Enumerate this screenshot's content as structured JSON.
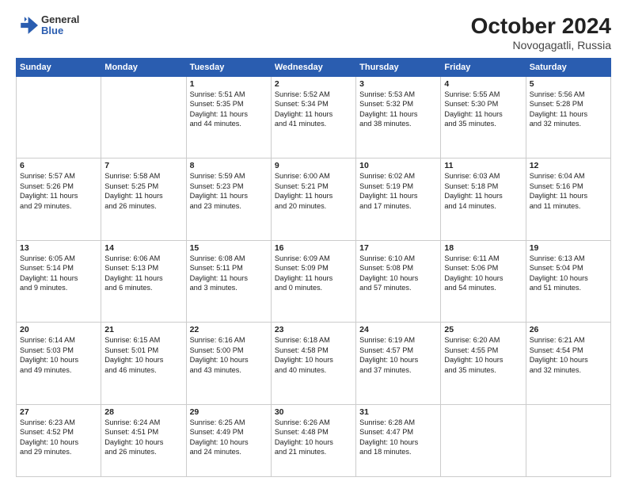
{
  "header": {
    "logo_general": "General",
    "logo_blue": "Blue",
    "month_year": "October 2024",
    "location": "Novogagatli, Russia"
  },
  "weekdays": [
    "Sunday",
    "Monday",
    "Tuesday",
    "Wednesday",
    "Thursday",
    "Friday",
    "Saturday"
  ],
  "weeks": [
    [
      {
        "day": "",
        "info": ""
      },
      {
        "day": "",
        "info": ""
      },
      {
        "day": "1",
        "info": "Sunrise: 5:51 AM\nSunset: 5:35 PM\nDaylight: 11 hours\nand 44 minutes."
      },
      {
        "day": "2",
        "info": "Sunrise: 5:52 AM\nSunset: 5:34 PM\nDaylight: 11 hours\nand 41 minutes."
      },
      {
        "day": "3",
        "info": "Sunrise: 5:53 AM\nSunset: 5:32 PM\nDaylight: 11 hours\nand 38 minutes."
      },
      {
        "day": "4",
        "info": "Sunrise: 5:55 AM\nSunset: 5:30 PM\nDaylight: 11 hours\nand 35 minutes."
      },
      {
        "day": "5",
        "info": "Sunrise: 5:56 AM\nSunset: 5:28 PM\nDaylight: 11 hours\nand 32 minutes."
      }
    ],
    [
      {
        "day": "6",
        "info": "Sunrise: 5:57 AM\nSunset: 5:26 PM\nDaylight: 11 hours\nand 29 minutes."
      },
      {
        "day": "7",
        "info": "Sunrise: 5:58 AM\nSunset: 5:25 PM\nDaylight: 11 hours\nand 26 minutes."
      },
      {
        "day": "8",
        "info": "Sunrise: 5:59 AM\nSunset: 5:23 PM\nDaylight: 11 hours\nand 23 minutes."
      },
      {
        "day": "9",
        "info": "Sunrise: 6:00 AM\nSunset: 5:21 PM\nDaylight: 11 hours\nand 20 minutes."
      },
      {
        "day": "10",
        "info": "Sunrise: 6:02 AM\nSunset: 5:19 PM\nDaylight: 11 hours\nand 17 minutes."
      },
      {
        "day": "11",
        "info": "Sunrise: 6:03 AM\nSunset: 5:18 PM\nDaylight: 11 hours\nand 14 minutes."
      },
      {
        "day": "12",
        "info": "Sunrise: 6:04 AM\nSunset: 5:16 PM\nDaylight: 11 hours\nand 11 minutes."
      }
    ],
    [
      {
        "day": "13",
        "info": "Sunrise: 6:05 AM\nSunset: 5:14 PM\nDaylight: 11 hours\nand 9 minutes."
      },
      {
        "day": "14",
        "info": "Sunrise: 6:06 AM\nSunset: 5:13 PM\nDaylight: 11 hours\nand 6 minutes."
      },
      {
        "day": "15",
        "info": "Sunrise: 6:08 AM\nSunset: 5:11 PM\nDaylight: 11 hours\nand 3 minutes."
      },
      {
        "day": "16",
        "info": "Sunrise: 6:09 AM\nSunset: 5:09 PM\nDaylight: 11 hours\nand 0 minutes."
      },
      {
        "day": "17",
        "info": "Sunrise: 6:10 AM\nSunset: 5:08 PM\nDaylight: 10 hours\nand 57 minutes."
      },
      {
        "day": "18",
        "info": "Sunrise: 6:11 AM\nSunset: 5:06 PM\nDaylight: 10 hours\nand 54 minutes."
      },
      {
        "day": "19",
        "info": "Sunrise: 6:13 AM\nSunset: 5:04 PM\nDaylight: 10 hours\nand 51 minutes."
      }
    ],
    [
      {
        "day": "20",
        "info": "Sunrise: 6:14 AM\nSunset: 5:03 PM\nDaylight: 10 hours\nand 49 minutes."
      },
      {
        "day": "21",
        "info": "Sunrise: 6:15 AM\nSunset: 5:01 PM\nDaylight: 10 hours\nand 46 minutes."
      },
      {
        "day": "22",
        "info": "Sunrise: 6:16 AM\nSunset: 5:00 PM\nDaylight: 10 hours\nand 43 minutes."
      },
      {
        "day": "23",
        "info": "Sunrise: 6:18 AM\nSunset: 4:58 PM\nDaylight: 10 hours\nand 40 minutes."
      },
      {
        "day": "24",
        "info": "Sunrise: 6:19 AM\nSunset: 4:57 PM\nDaylight: 10 hours\nand 37 minutes."
      },
      {
        "day": "25",
        "info": "Sunrise: 6:20 AM\nSunset: 4:55 PM\nDaylight: 10 hours\nand 35 minutes."
      },
      {
        "day": "26",
        "info": "Sunrise: 6:21 AM\nSunset: 4:54 PM\nDaylight: 10 hours\nand 32 minutes."
      }
    ],
    [
      {
        "day": "27",
        "info": "Sunrise: 6:23 AM\nSunset: 4:52 PM\nDaylight: 10 hours\nand 29 minutes."
      },
      {
        "day": "28",
        "info": "Sunrise: 6:24 AM\nSunset: 4:51 PM\nDaylight: 10 hours\nand 26 minutes."
      },
      {
        "day": "29",
        "info": "Sunrise: 6:25 AM\nSunset: 4:49 PM\nDaylight: 10 hours\nand 24 minutes."
      },
      {
        "day": "30",
        "info": "Sunrise: 6:26 AM\nSunset: 4:48 PM\nDaylight: 10 hours\nand 21 minutes."
      },
      {
        "day": "31",
        "info": "Sunrise: 6:28 AM\nSunset: 4:47 PM\nDaylight: 10 hours\nand 18 minutes."
      },
      {
        "day": "",
        "info": ""
      },
      {
        "day": "",
        "info": ""
      }
    ]
  ]
}
